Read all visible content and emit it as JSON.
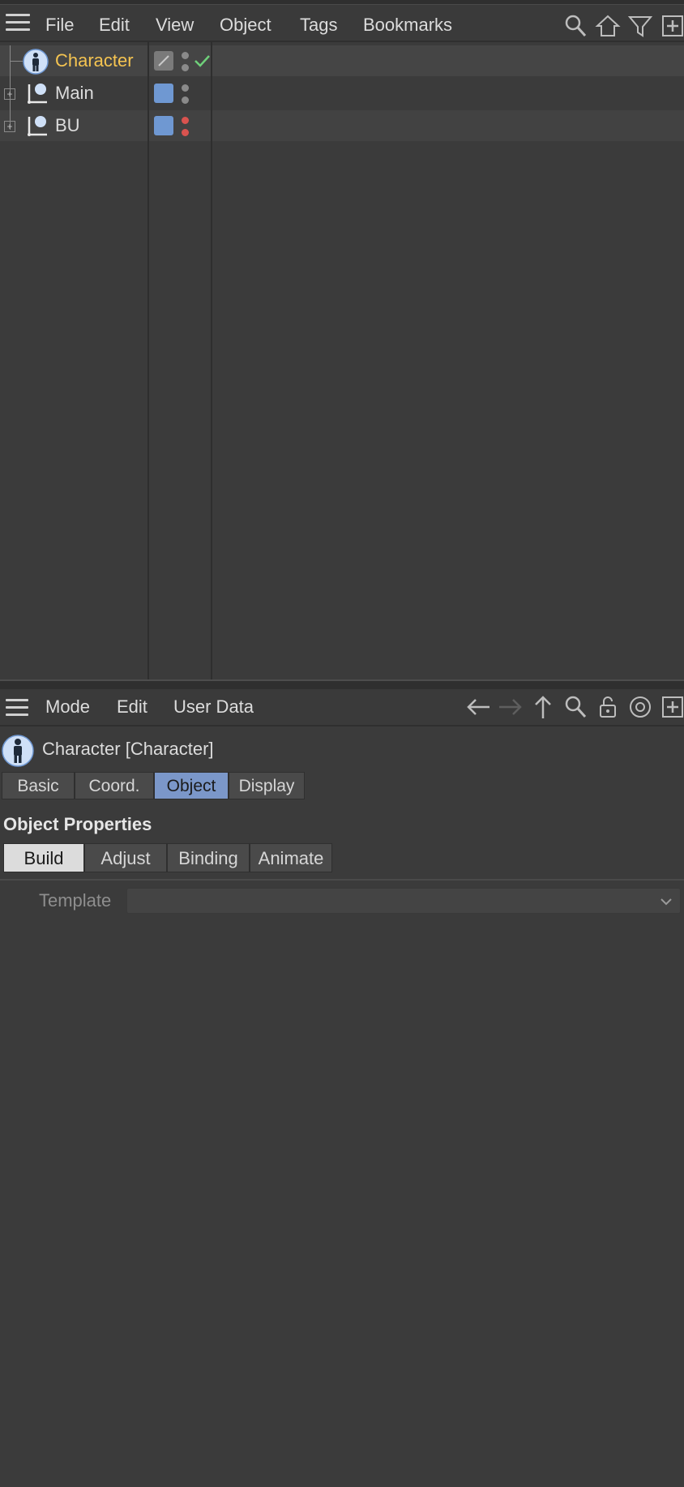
{
  "object_manager": {
    "menu": [
      "File",
      "Edit",
      "View",
      "Object",
      "Tags",
      "Bookmarks"
    ],
    "toolbar_icons": [
      "search-icon",
      "home-icon",
      "filter-icon",
      "new-panel-icon"
    ],
    "objects": [
      {
        "name": "Character",
        "icon": "character-icon",
        "selected": true,
        "color": "#f5c451",
        "layer_swatch": "#7a7a7a",
        "dot_top": "#8a8a8a",
        "dot_bottom": "#8a8a8a",
        "tag": "check-icon"
      },
      {
        "name": "Main",
        "icon": "joint-icon",
        "expandable": true,
        "color": "#dcdcdc",
        "layer_swatch": "#6f98d2",
        "dot_top": "#8a8a8a",
        "dot_bottom": "#8a8a8a"
      },
      {
        "name": "BU",
        "icon": "joint-icon",
        "expandable": true,
        "color": "#dcdcdc",
        "layer_swatch": "#6f98d2",
        "dot_top": "#d9534f",
        "dot_bottom": "#d9534f"
      }
    ]
  },
  "attribute_manager": {
    "menu": [
      "Mode",
      "Edit",
      "User Data"
    ],
    "toolbar_icons": [
      "back-arrow-icon",
      "forward-arrow-icon",
      "up-arrow-icon",
      "search-icon",
      "lock-icon",
      "target-icon",
      "new-panel-icon"
    ],
    "title": "Character [Character]",
    "tabs": [
      {
        "label": "Basic",
        "active": false
      },
      {
        "label": "Coord.",
        "active": false
      },
      {
        "label": "Object",
        "active": true
      },
      {
        "label": "Display",
        "active": false
      }
    ],
    "section_title": "Object Properties",
    "subtabs": [
      {
        "label": "Build",
        "active": true
      },
      {
        "label": "Adjust",
        "active": false
      },
      {
        "label": "Binding",
        "active": false
      },
      {
        "label": "Animate",
        "active": false
      }
    ],
    "template": {
      "label": "Template",
      "value": ""
    }
  },
  "colors": {
    "background": "#3b3b3b",
    "accent": "#7b97c9",
    "selected_text": "#f5c451",
    "check": "#6fd07a"
  }
}
